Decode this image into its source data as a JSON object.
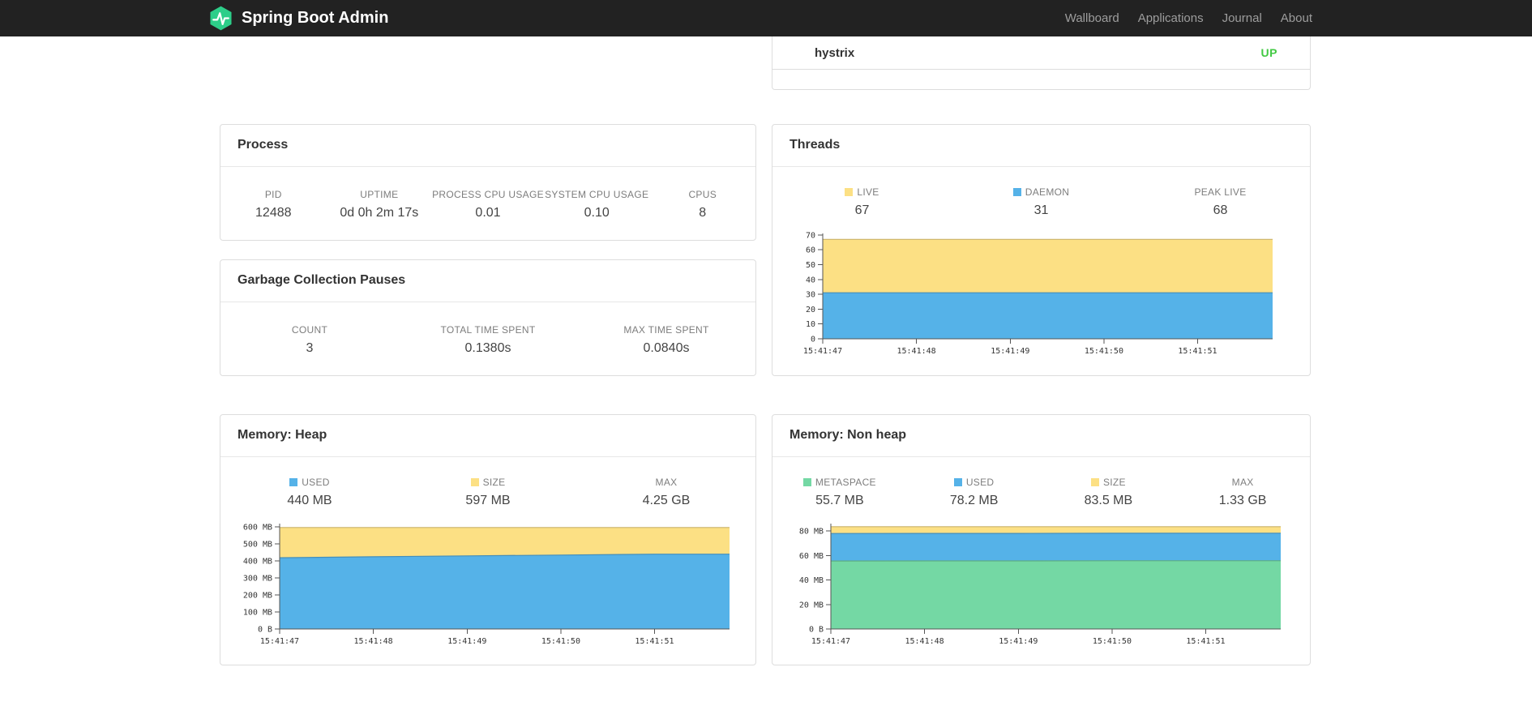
{
  "colors": {
    "navbar_bg": "#222222",
    "brand_green": "#2dce89",
    "status_up": "#42c943",
    "chart_blue": "#55b2e8",
    "chart_yellow": "#fce084",
    "chart_green": "#74d8a4"
  },
  "navbar": {
    "brand": "Spring Boot Admin",
    "links": [
      {
        "label": "Wallboard"
      },
      {
        "label": "Applications"
      },
      {
        "label": "Journal"
      },
      {
        "label": "About"
      }
    ]
  },
  "application_row": {
    "name": "hystrix",
    "status": "UP"
  },
  "cards": {
    "process": {
      "title": "Process",
      "stats": [
        {
          "label": "PID",
          "value": "12488"
        },
        {
          "label": "UPTIME",
          "value": "0d 0h 2m 17s"
        },
        {
          "label": "PROCESS CPU USAGE",
          "value": "0.01"
        },
        {
          "label": "SYSTEM CPU USAGE",
          "value": "0.10"
        },
        {
          "label": "CPUS",
          "value": "8"
        }
      ]
    },
    "gc": {
      "title": "Garbage Collection Pauses",
      "stats": [
        {
          "label": "COUNT",
          "value": "3"
        },
        {
          "label": "TOTAL TIME SPENT",
          "value": "0.1380s"
        },
        {
          "label": "MAX TIME SPENT",
          "value": "0.0840s"
        }
      ]
    },
    "threads": {
      "title": "Threads",
      "stats": [
        {
          "label": "LIVE",
          "value": "67",
          "swatch": "#fce084"
        },
        {
          "label": "DAEMON",
          "value": "31",
          "swatch": "#55b2e8"
        },
        {
          "label": "PEAK LIVE",
          "value": "68"
        }
      ]
    },
    "heap": {
      "title": "Memory: Heap",
      "stats": [
        {
          "label": "USED",
          "value": "440 MB",
          "swatch": "#55b2e8"
        },
        {
          "label": "SIZE",
          "value": "597 MB",
          "swatch": "#fce084"
        },
        {
          "label": "MAX",
          "value": "4.25 GB"
        }
      ]
    },
    "nonheap": {
      "title": "Memory: Non heap",
      "stats": [
        {
          "label": "METASPACE",
          "value": "55.7 MB",
          "swatch": "#74d8a4"
        },
        {
          "label": "USED",
          "value": "78.2 MB",
          "swatch": "#55b2e8"
        },
        {
          "label": "SIZE",
          "value": "83.5 MB",
          "swatch": "#fce084"
        },
        {
          "label": "MAX",
          "value": "1.33 GB"
        }
      ]
    }
  },
  "chart_data": [
    {
      "id": "threads",
      "type": "area",
      "title": "Threads",
      "xlabel": "",
      "ylabel": "",
      "grid": false,
      "legend_position": "top",
      "x": [
        "15:41:47",
        "15:41:48",
        "15:41:49",
        "15:41:50",
        "15:41:51"
      ],
      "ylim": [
        0,
        71
      ],
      "yticks": [
        {
          "v": 0,
          "label": "0"
        },
        {
          "v": 10,
          "label": "10"
        },
        {
          "v": 20,
          "label": "20"
        },
        {
          "v": 30,
          "label": "30"
        },
        {
          "v": 40,
          "label": "40"
        },
        {
          "v": 50,
          "label": "50"
        },
        {
          "v": 60,
          "label": "60"
        },
        {
          "v": 70,
          "label": "70"
        }
      ],
      "series": [
        {
          "name": "LIVE",
          "color": "#fce084",
          "values": [
            67,
            67,
            67,
            67,
            67
          ]
        },
        {
          "name": "DAEMON",
          "color": "#55b2e8",
          "values": [
            31,
            31,
            31,
            31,
            31
          ]
        }
      ]
    },
    {
      "id": "heap",
      "type": "area",
      "title": "Memory: Heap",
      "xlabel": "",
      "ylabel": "",
      "grid": false,
      "legend_position": "top",
      "x": [
        "15:41:47",
        "15:41:48",
        "15:41:49",
        "15:41:50",
        "15:41:51"
      ],
      "ylim": [
        0,
        620
      ],
      "yticks": [
        {
          "v": 0,
          "label": "0 B"
        },
        {
          "v": 100,
          "label": "100 MB"
        },
        {
          "v": 200,
          "label": "200 MB"
        },
        {
          "v": 300,
          "label": "300 MB"
        },
        {
          "v": 400,
          "label": "400 MB"
        },
        {
          "v": 500,
          "label": "500 MB"
        },
        {
          "v": 600,
          "label": "600 MB"
        }
      ],
      "series": [
        {
          "name": "SIZE",
          "color": "#fce084",
          "values": [
            597,
            597,
            597,
            597,
            597
          ]
        },
        {
          "name": "USED",
          "color": "#55b2e8",
          "values": [
            419,
            425,
            430,
            435,
            440
          ]
        }
      ]
    },
    {
      "id": "nonheap",
      "type": "area",
      "title": "Memory: Non heap",
      "xlabel": "",
      "ylabel": "",
      "grid": false,
      "legend_position": "top",
      "x": [
        "15:41:47",
        "15:41:48",
        "15:41:49",
        "15:41:50",
        "15:41:51"
      ],
      "ylim": [
        0,
        86
      ],
      "yticks": [
        {
          "v": 0,
          "label": "0 B"
        },
        {
          "v": 20,
          "label": "20 MB"
        },
        {
          "v": 40,
          "label": "40 MB"
        },
        {
          "v": 60,
          "label": "60 MB"
        },
        {
          "v": 80,
          "label": "80 MB"
        }
      ],
      "series": [
        {
          "name": "SIZE",
          "color": "#fce084",
          "values": [
            83.5,
            83.5,
            83.5,
            83.5,
            83.5
          ]
        },
        {
          "name": "USED",
          "color": "#55b2e8",
          "values": [
            77.9,
            78.0,
            78.0,
            78.1,
            78.2
          ]
        },
        {
          "name": "METASPACE",
          "color": "#74d8a4",
          "values": [
            55.5,
            55.6,
            55.6,
            55.7,
            55.7
          ]
        }
      ]
    }
  ]
}
